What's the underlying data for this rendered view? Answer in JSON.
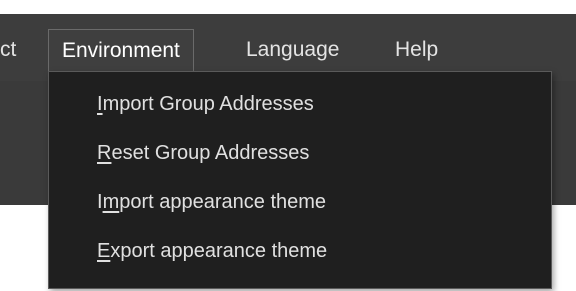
{
  "menubar": {
    "items": [
      {
        "label": "ct"
      },
      {
        "label": "Environment"
      },
      {
        "label": "Language"
      },
      {
        "label": "Help"
      }
    ]
  },
  "dropdown": {
    "items": [
      {
        "mnemonic": "I",
        "rest": "mport Group Addresses"
      },
      {
        "mnemonic": "R",
        "rest": "eset Group Addresses"
      },
      {
        "pre": "I",
        "mnemonic": "m",
        "rest": "port appearance theme"
      },
      {
        "mnemonic": "E",
        "rest": "xport appearance theme"
      }
    ]
  },
  "colors": {
    "menubar_bg": "#3d3d3d",
    "dropdown_bg": "#1f1f1f",
    "text": "#e0e0e0"
  }
}
